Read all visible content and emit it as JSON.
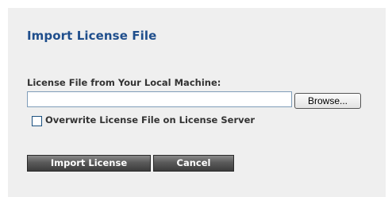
{
  "dialog": {
    "title": "Import License File"
  },
  "file_field": {
    "label": "License File from Your Local Machine:",
    "value": "",
    "browse_label": "Browse..."
  },
  "overwrite_option": {
    "label": "Overwrite License File on License Server",
    "checked": false
  },
  "actions": {
    "import_label": "Import License",
    "cancel_label": "Cancel"
  },
  "colors": {
    "panel_background": "#efefef",
    "title": "#1f4e8c",
    "button_dark": "#4a4a4a"
  }
}
